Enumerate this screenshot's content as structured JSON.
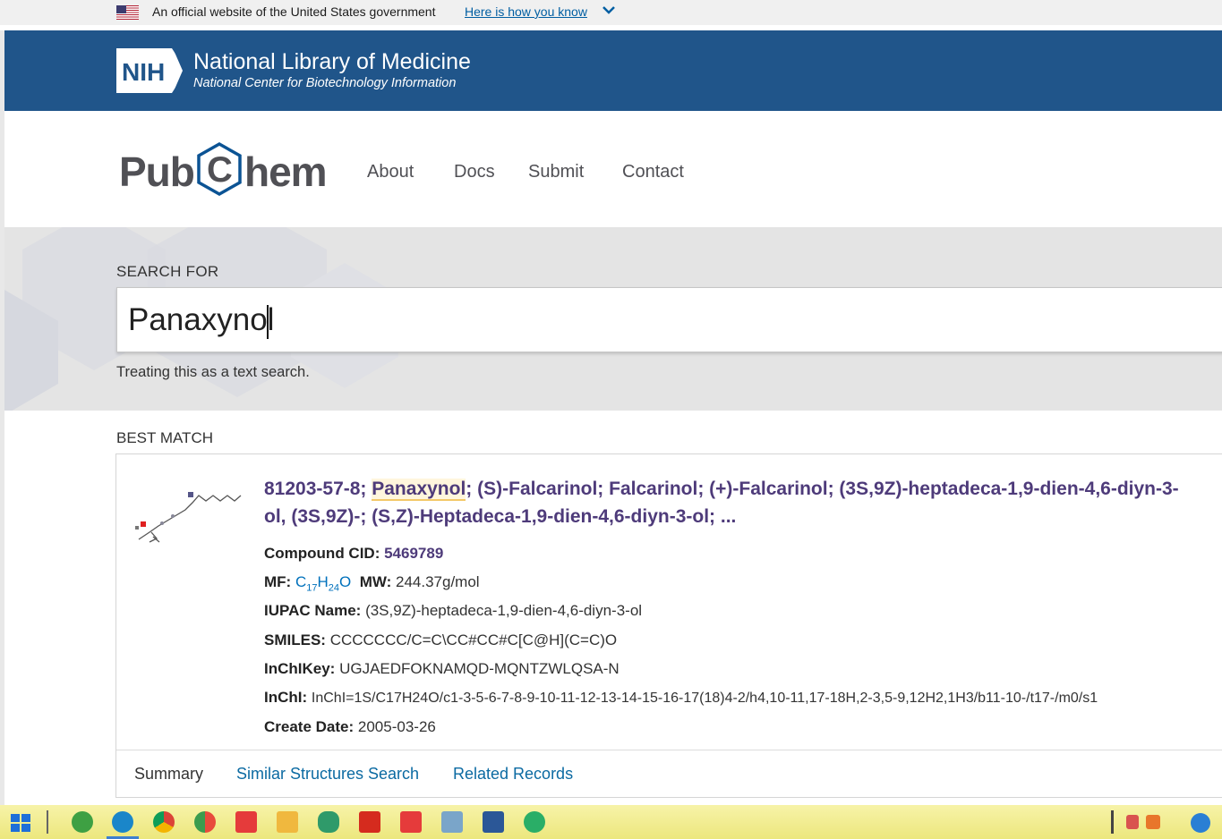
{
  "gov_banner": {
    "text": "An official website of the United States government",
    "link": "Here is how you know"
  },
  "nih": {
    "logo_text": "NIH",
    "title": "National Library of Medicine",
    "subtitle": "National Center for Biotechnology Information"
  },
  "pubchem": {
    "logo_left": "Pub",
    "logo_c": "C",
    "logo_right": "hem",
    "nav": [
      "About",
      "Docs",
      "Submit",
      "Contact"
    ]
  },
  "search": {
    "label": "SEARCH FOR",
    "value": "Panaxynol",
    "hint": "Treating this as a text search."
  },
  "best_match": {
    "label": "BEST MATCH",
    "title_prefix": "81203-57-8; ",
    "title_highlight": "Panaxynol",
    "title_rest": "; (S)-Falcarinol; Falcarinol; (+)-Falcarinol; (3S,9Z)-heptadeca-1,9-dien-4,6-diyn-3-",
    "title_line2": "ol, (3S,9Z)-; (S,Z)-Heptadeca-1,9-dien-4,6-diyn-3-ol; ...",
    "cid_label": "Compound CID:",
    "cid_value": "5469789",
    "mf_label": "MF:",
    "mf_c": "C",
    "mf_c_sub": "17",
    "mf_h": "H",
    "mf_h_sub": "24",
    "mf_o": "O",
    "mw_label": "MW:",
    "mw_value": "244.37g/mol",
    "iupac_label": "IUPAC Name:",
    "iupac_value": "(3S,9Z)-heptadeca-1,9-dien-4,6-diyn-3-ol",
    "smiles_label": "SMILES:",
    "smiles_value": "CCCCCCC/C=C\\CC#CC#C[C@H](C=C)O",
    "inchikey_label": "InChIKey:",
    "inchikey_value": "UGJAEDFOKNAMQD-MQNTZWLQSA-N",
    "inchi_label": "InChI:",
    "inchi_value": "InChI=1S/C17H24O/c1-3-5-6-7-8-9-10-11-12-13-14-15-16-17(18)4-2/h4,10-11,17-18H,2-3,5-9,12H2,1H3/b11-10-/t17-/m0/s1",
    "date_label": "Create Date:",
    "date_value": "2005-03-26",
    "tabs": [
      "Summary",
      "Similar Structures Search",
      "Related Records"
    ]
  },
  "colors": {
    "nih_blue": "#20558a",
    "pubchem_purple": "#4e3b7a",
    "link_blue": "#0071bc"
  },
  "taskbar_icons": [
    "windows-start-icon",
    "ie-icon",
    "edge-icon",
    "chrome-icon",
    "app-icon",
    "youdao-icon",
    "folder-icon",
    "app2-icon",
    "pdf-icon",
    "youdao2-icon",
    "remote-icon",
    "word-icon",
    "wechat-icon"
  ]
}
